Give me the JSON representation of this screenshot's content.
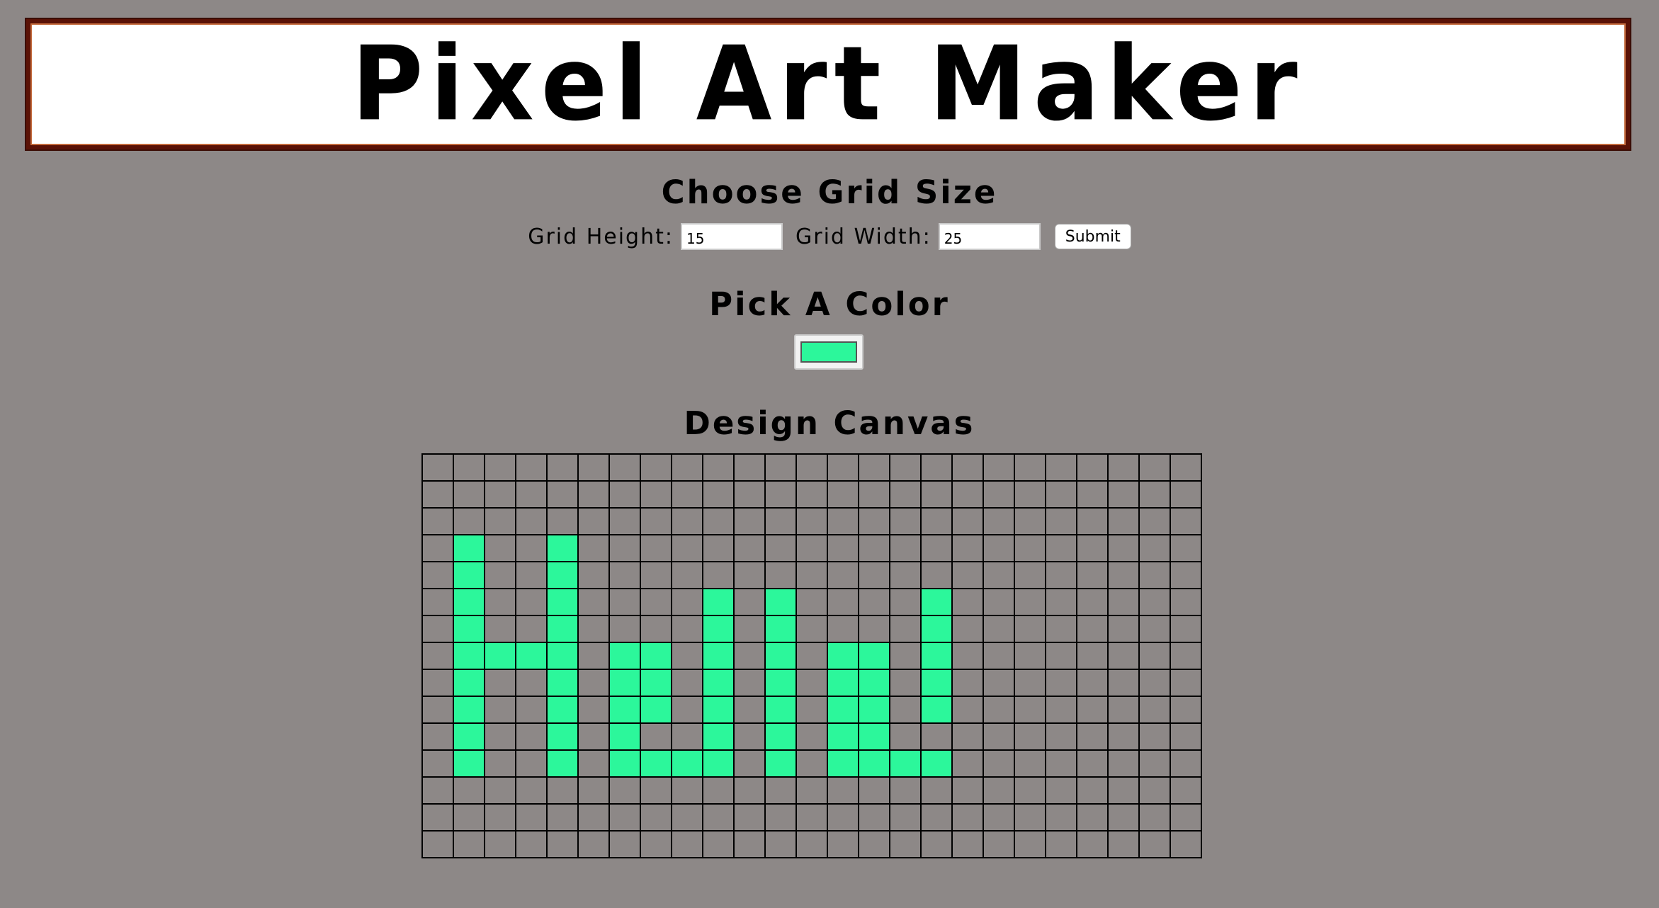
{
  "header": {
    "title": "Pixel Art Maker"
  },
  "size_form": {
    "heading": "Choose Grid Size",
    "height_label": "Grid Height:",
    "height_value": "15",
    "width_label": "Grid Width:",
    "width_value": "25",
    "submit_label": "Submit"
  },
  "color": {
    "heading": "Pick A Color",
    "value": "#2cf79b"
  },
  "canvas": {
    "heading": "Design Canvas",
    "rows": 15,
    "cols": 25,
    "fill_color": "#2cf79b",
    "empty_color": "#8d8887",
    "pixels": [
      "0000000000000000000000000",
      "0000000000000000000000000",
      "0000000000000000000000000",
      "0100100000000000000000000",
      "0100100000000000000000000",
      "0100100001010000100000000",
      "0100100001010000100000000",
      "0111101101010110100000000",
      "0100101101010110100000000",
      "0100101101010110100000000",
      "0100101001010110000000000",
      "0100101111010111100000000",
      "0000000000000000000000000",
      "0000000000000000000000000",
      "0000000000000000000000000"
    ]
  }
}
